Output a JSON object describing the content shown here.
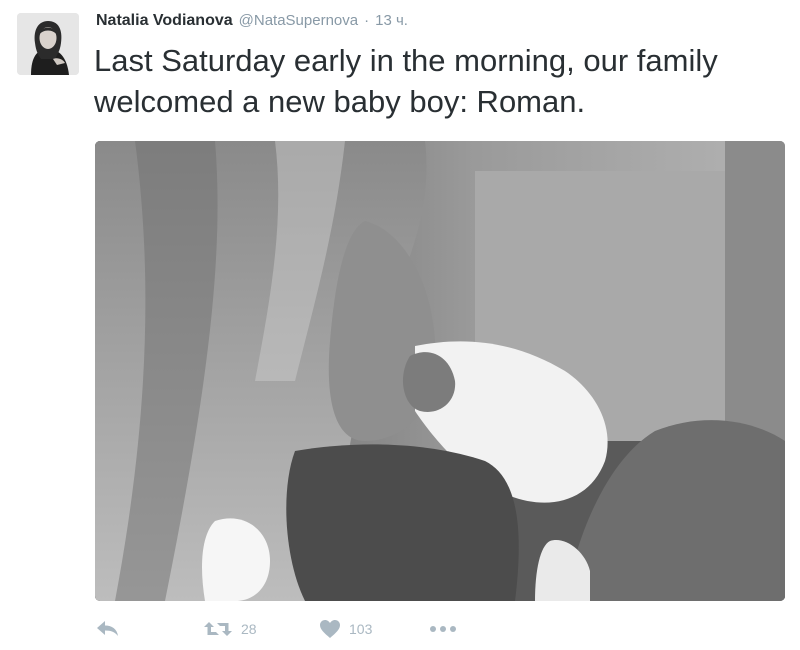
{
  "tweet": {
    "author": {
      "name": "Natalia Vodianova",
      "handle": "@NataSupernova",
      "separator": "·",
      "time": "13 ч."
    },
    "text": "Last Saturday early in the morning, our family welcomed a new baby boy: Roman.",
    "actions": {
      "reply_icon": "reply-icon",
      "retweet_icon": "retweet-icon",
      "retweet_count": "28",
      "like_icon": "heart-icon",
      "like_count": "103",
      "more_icon": "more-icon"
    }
  },
  "colors": {
    "text": "#292f33",
    "muted": "#8899a6",
    "action_gray": "#aab8c2"
  }
}
